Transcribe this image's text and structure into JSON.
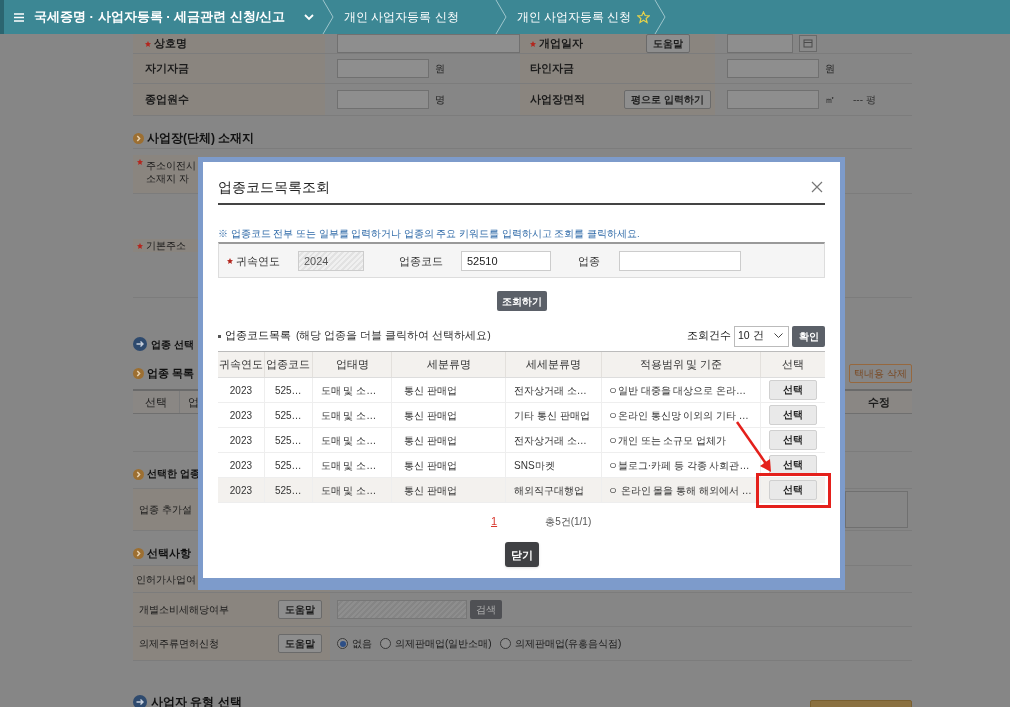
{
  "top_bar": {
    "menu_title": "국세증명 · 사업자등록 · 세금관련 신청/신고",
    "breadcrumbs": [
      "개인 사업자등록 신청",
      "개인 사업자등록 신청"
    ],
    "favorite": true
  },
  "basic_rows": [
    {
      "left": {
        "label": "상호명",
        "required": true
      },
      "right": {
        "label": "개업일자",
        "required": true,
        "button": "도움말",
        "kind": "date"
      }
    },
    {
      "left": {
        "label": "자기자금",
        "required": false,
        "unit": "원"
      },
      "right": {
        "label": "타인자금",
        "required": false,
        "unit": "원",
        "kind": "amount"
      }
    },
    {
      "left": {
        "label": "종업원수",
        "required": false,
        "unit": "명"
      },
      "right": {
        "label": "사업장면적",
        "required": false,
        "button": "평으로 입력하기",
        "unit": "㎡",
        "extra": "--- 평",
        "kind": "area"
      }
    }
  ],
  "address_section": {
    "title": "사업장(단체) 소재지",
    "rows": [
      {
        "label_lines": [
          "주소이전시",
          "소재지 자"
        ],
        "required": true
      },
      {
        "label_lines": [
          "기본주소"
        ],
        "required": true
      }
    ]
  },
  "industry_section": {
    "title": "업종 선택",
    "list_title": "업종 목록",
    "delete_button": "택내용 삭제",
    "columns": [
      "선택",
      "업"
    ],
    "right_column": "수정",
    "selected_title": "선택한 업종",
    "extra_label": "업종 추가설"
  },
  "options_section": {
    "title": "선택사항",
    "rows": [
      {
        "kind": "plain",
        "label": "인허가사업여"
      },
      {
        "kind": "search",
        "label": "개별소비세해당여부",
        "button": "도움말",
        "search_button": "검색"
      },
      {
        "kind": "radio",
        "label": "의제주류면허신청",
        "button": "도움말",
        "options": [
          {
            "label": "없음",
            "selected": true
          },
          {
            "label": "의제판매업(일반소매)",
            "selected": false
          },
          {
            "label": "의제판매업(유흥음식점)",
            "selected": false
          }
        ]
      }
    ]
  },
  "next_section_title": "사업자 유형 선택",
  "dialog": {
    "title": "업종코드목록조회",
    "hint": "※ 업종코드 전부 또는 일부를 입력하거나 업종의 주요 키워드를 입력하시고 조회를 클릭하세요.",
    "fields": [
      {
        "label": "귀속연도",
        "required": true,
        "value": "2024",
        "disabled": true
      },
      {
        "label": "업종코드",
        "required": false,
        "value": "52510",
        "disabled": false
      },
      {
        "label": "업종",
        "required": false,
        "disabled": false
      }
    ],
    "search_button": "조회하기",
    "list_title": "업종코드목록",
    "list_hint": "(해당 업종을 더블 클릭하여 선택하세요)",
    "count_label": "조회건수",
    "count_value": "10 건",
    "confirm_button": "확인",
    "table": {
      "columns": [
        "귀속연도",
        "업종코드",
        "업태명",
        "세분류명",
        "세세분류명",
        "적용범위 및 기준",
        "선택"
      ],
      "rows": [
        {
          "cells": [
            "2023",
            "525…",
            "도매 및 소…",
            "통신 판매업",
            "전자상거래 소…",
            "ㅇ일반 대중을 대상으로 온라…"
          ],
          "action": "선택",
          "selected": false,
          "highlighted": false
        },
        {
          "cells": [
            "2023",
            "525…",
            "도매 및 소…",
            "통신 판매업",
            "기타 통신 판매업",
            "ㅇ온라인 통신망 이외의 기타 …"
          ],
          "action": "선택",
          "selected": false,
          "highlighted": false
        },
        {
          "cells": [
            "2023",
            "525…",
            "도매 및 소…",
            "통신 판매업",
            "전자상거래 소…",
            "ㅇ개인 또는 소규모 업체가"
          ],
          "action": "선택",
          "selected": false,
          "highlighted": false
        },
        {
          "cells": [
            "2023",
            "525…",
            "도매 및 소…",
            "통신 판매업",
            "SNS마켓",
            "ㅇ블로그·카페 등 각종 사회관…"
          ],
          "action": "선택",
          "selected": false,
          "highlighted": false
        },
        {
          "cells": [
            "2023",
            "525…",
            "도매 및 소…",
            "통신 판매업",
            "해외직구대행업",
            "ㅇ 온라인 몰을 통해 해외에서 …"
          ],
          "action": "선택",
          "selected": true,
          "highlighted": true
        }
      ]
    },
    "pagination": {
      "pages": [
        {
          "label": "1",
          "selected": true
        }
      ],
      "total": "총5건(1/1)"
    },
    "close_button": "닫기"
  }
}
